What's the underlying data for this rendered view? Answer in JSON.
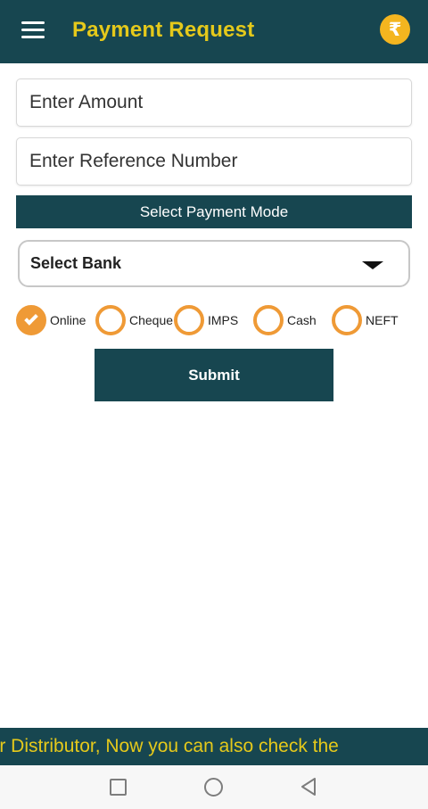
{
  "header": {
    "title": "Payment Request",
    "wallet_icon_glyph": "₹",
    "title_color": "#e5c91b",
    "bar_color": "#174650"
  },
  "form": {
    "amount_placeholder": "Enter Amount",
    "reference_placeholder": "Enter Reference Number",
    "payment_mode_header": "Select Payment Mode",
    "bank_select": {
      "selected": "Select Bank"
    },
    "payment_modes": [
      {
        "label": "Online",
        "checked": true
      },
      {
        "label": "Cheque",
        "checked": false
      },
      {
        "label": "IMPS",
        "checked": false
      },
      {
        "label": "Cash",
        "checked": false
      },
      {
        "label": "NEFT",
        "checked": false
      }
    ],
    "submit_label": "Submit",
    "accent_color": "#ef9a36"
  },
  "ticker": {
    "text": "ear Distributor, Now you can also check the"
  },
  "system_nav": {
    "icons": [
      "recent-apps-icon",
      "home-icon",
      "back-icon"
    ]
  }
}
